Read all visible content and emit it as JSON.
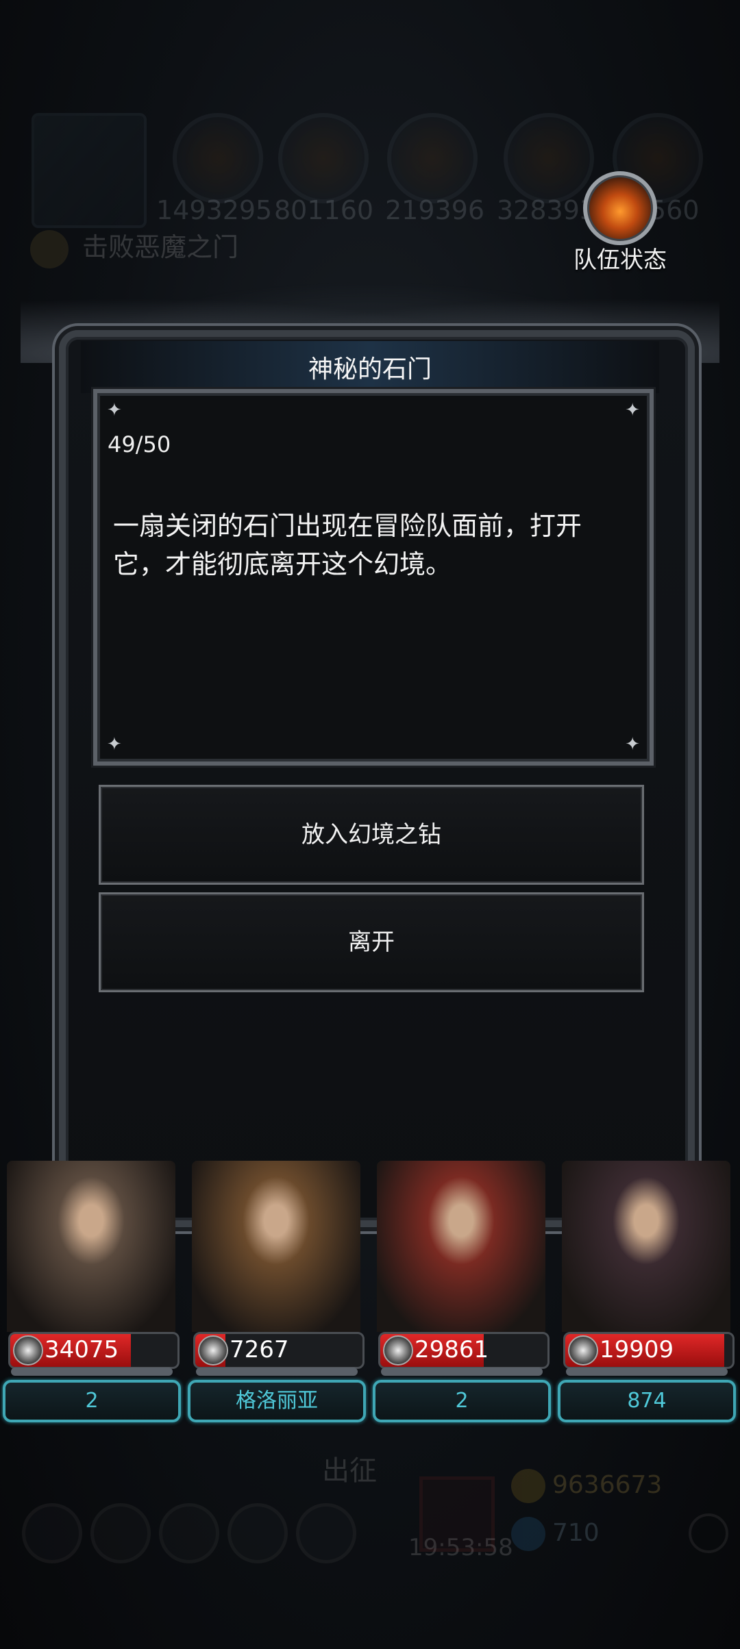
{
  "hud": {
    "resources": [
      "1493295",
      "801160",
      "219396",
      "3283939",
      "560"
    ],
    "task": "击败恶魔之门",
    "bottom_label": "出征",
    "time": "19:53:58",
    "gold": "9636673",
    "gems": "710"
  },
  "team_button": {
    "label": "队伍状态",
    "icon": "flame-emblem-icon"
  },
  "dialog": {
    "title": "神秘的石门",
    "counter": "49/50",
    "description": "一扇关闭的石门出现在冒险队面前，打开它，才能彻底离开这个幻境。",
    "options": [
      {
        "label": "放入幻境之钻"
      },
      {
        "label": "离开"
      }
    ]
  },
  "heroes": [
    {
      "hp": "34075",
      "hp_fraction": 0.72,
      "plate": "2",
      "art_color": "#5a4a3e"
    },
    {
      "hp": "7267",
      "hp_fraction": 0.18,
      "plate": "格洛丽亚",
      "art_color": "#6a4a2c"
    },
    {
      "hp": "29861",
      "hp_fraction": 0.62,
      "plate": "2",
      "art_color": "#7a2a22"
    },
    {
      "hp": "19909",
      "hp_fraction": 0.95,
      "plate": "874",
      "art_color": "#3a2a30"
    }
  ]
}
